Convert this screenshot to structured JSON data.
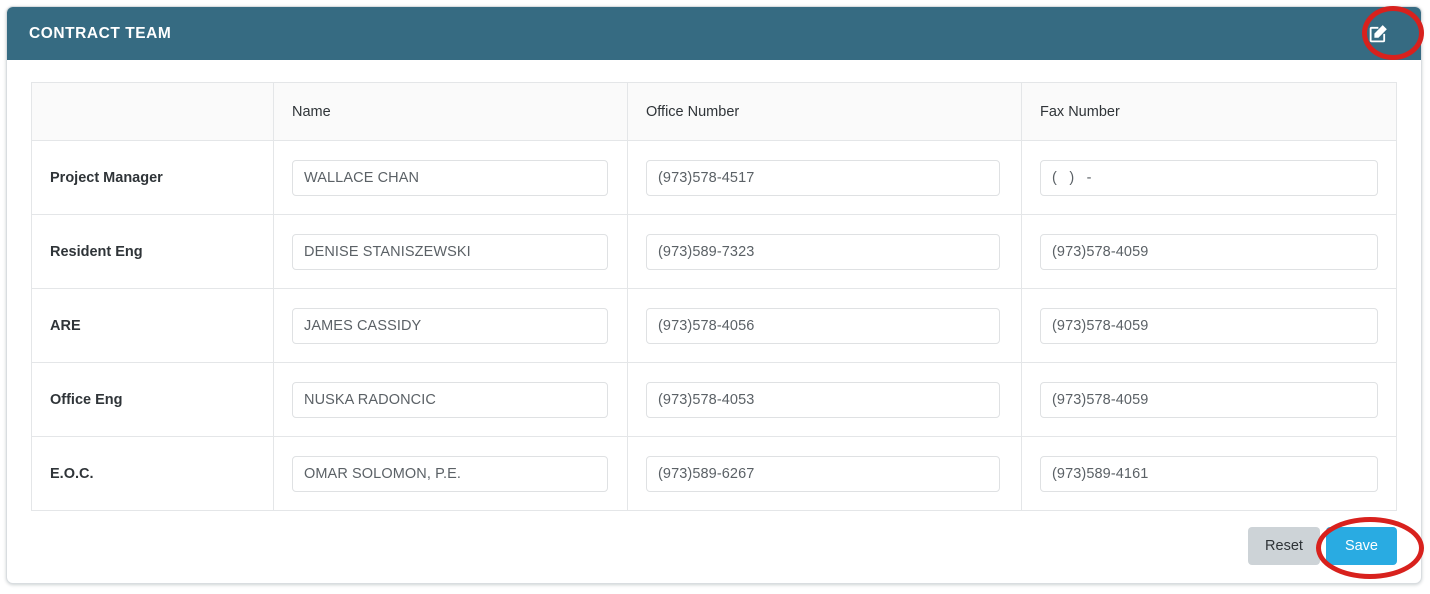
{
  "header": {
    "title": "CONTRACT TEAM",
    "edit_icon": "edit-pencil-square-icon",
    "background_color": "#366B82",
    "title_color": "#FFFFFF"
  },
  "table": {
    "columns": [
      "",
      "Name",
      "Office Number",
      "Fax Number"
    ],
    "rows": [
      {
        "role": "Project Manager",
        "name": "WALLACE CHAN",
        "office_number": "(973)578-4517",
        "fax_number": "(   )   -"
      },
      {
        "role": "Resident Eng",
        "name": "DENISE STANISZEWSKI",
        "office_number": "(973)589-7323",
        "fax_number": "(973)578-4059"
      },
      {
        "role": "ARE",
        "name": "JAMES CASSIDY",
        "office_number": "(973)578-4056",
        "fax_number": "(973)578-4059"
      },
      {
        "role": "Office Eng",
        "name": "NUSKA RADONCIC",
        "office_number": "(973)578-4053",
        "fax_number": "(973)578-4059"
      },
      {
        "role": "E.O.C.",
        "name": "OMAR SOLOMON, P.E.",
        "office_number": "(973)589-6267",
        "fax_number": "(973)589-4161"
      }
    ]
  },
  "footer": {
    "reset_label": "Reset",
    "save_label": "Save",
    "save_color": "#29ABE2",
    "reset_color": "#CDD3D7"
  },
  "annotations": {
    "color": "#D8211D",
    "edit_icon_highlight": "ellipse around edit icon",
    "save_button_highlight": "ellipse around Save button"
  }
}
